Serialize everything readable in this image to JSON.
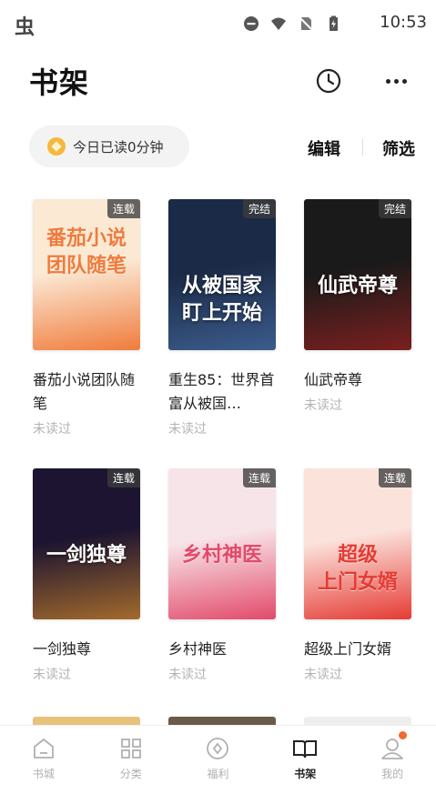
{
  "status_bar": {
    "time": "10:53",
    "app_glyph": "虫"
  },
  "header": {
    "title": "书架"
  },
  "reading": {
    "text": "今日已读0分钟"
  },
  "actions": {
    "edit": "编辑",
    "filter": "筛选"
  },
  "books": [
    {
      "title": "番茄小说团队随笔",
      "status": "未读过",
      "badge": "连载",
      "cover_text": "番茄小说\n团队随笔",
      "cover_colors": [
        "#fbe9d4",
        "#f07b3c"
      ]
    },
    {
      "title": "重生85：世界首富从被国…",
      "status": "未读过",
      "badge": "完结",
      "cover_text": "从被国家\n盯上开始",
      "cover_colors": [
        "#1b2a46",
        "#3b5c8c"
      ]
    },
    {
      "title": "仙武帝尊",
      "status": "未读过",
      "badge": "完结",
      "cover_text": "仙武帝尊",
      "cover_colors": [
        "#1a1a1a",
        "#7a1f1f"
      ]
    },
    {
      "title": "一剑独尊",
      "status": "未读过",
      "badge": "连载",
      "cover_text": "一剑独尊",
      "cover_colors": [
        "#1c1430",
        "#a36a2c"
      ]
    },
    {
      "title": "乡村神医",
      "status": "未读过",
      "badge": "连载",
      "cover_text": "乡村神医",
      "cover_colors": [
        "#f7e4e8",
        "#e24a6a"
      ]
    },
    {
      "title": "超级上门女婿",
      "status": "未读过",
      "badge": "连载",
      "cover_text": "超级\n上门女婿",
      "cover_colors": [
        "#fbe3dc",
        "#e53b34"
      ]
    }
  ],
  "nav": [
    {
      "label": "书城",
      "icon": "home-icon"
    },
    {
      "label": "分类",
      "icon": "grid-icon"
    },
    {
      "label": "福利",
      "icon": "coin-icon"
    },
    {
      "label": "书架",
      "icon": "book-open-icon",
      "active": true
    },
    {
      "label": "我的",
      "icon": "user-icon"
    }
  ],
  "colors": {
    "accent": "#f26a2e",
    "muted": "#b3b3b3"
  }
}
